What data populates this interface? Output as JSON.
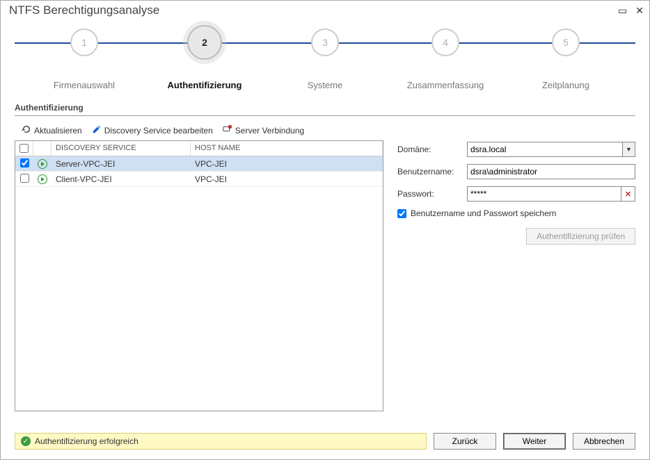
{
  "window": {
    "title": "NTFS Berechtigungsanalyse"
  },
  "stepper": {
    "steps": [
      {
        "num": "1",
        "label": "Firmenauswahl"
      },
      {
        "num": "2",
        "label": "Authentifizierung"
      },
      {
        "num": "3",
        "label": "Systeme"
      },
      {
        "num": "4",
        "label": "Zusammenfassung"
      },
      {
        "num": "5",
        "label": "Zeitplanung"
      }
    ],
    "active_index": 1
  },
  "section": {
    "title": "Authentifizierung"
  },
  "toolbar": {
    "refresh": "Aktualisieren",
    "edit": "Discovery Service bearbeiten",
    "connect": "Server Verbindung"
  },
  "table": {
    "headers": {
      "discovery": "DISCOVERY SERVICE",
      "host": "HOST NAME"
    },
    "rows": [
      {
        "checked": true,
        "selected": true,
        "discovery": "Server-VPC-JEI",
        "host": "VPC-JEI"
      },
      {
        "checked": false,
        "selected": false,
        "discovery": "Client-VPC-JEI",
        "host": "VPC-JEI"
      }
    ]
  },
  "form": {
    "domain_label": "Domäne:",
    "domain_value": "dsra.local",
    "user_label": "Benutzername:",
    "user_value": "dsra\\administrator",
    "pass_label": "Passwort:",
    "pass_value": "*****",
    "save_creds_label": "Benutzername und Passwort speichern",
    "save_creds_checked": true,
    "check_auth_label": "Authentifizierung prüfen"
  },
  "footer": {
    "status": "Authentifizierung erfolgreich",
    "back": "Zurück",
    "next": "Weiter",
    "cancel": "Abbrechen"
  }
}
